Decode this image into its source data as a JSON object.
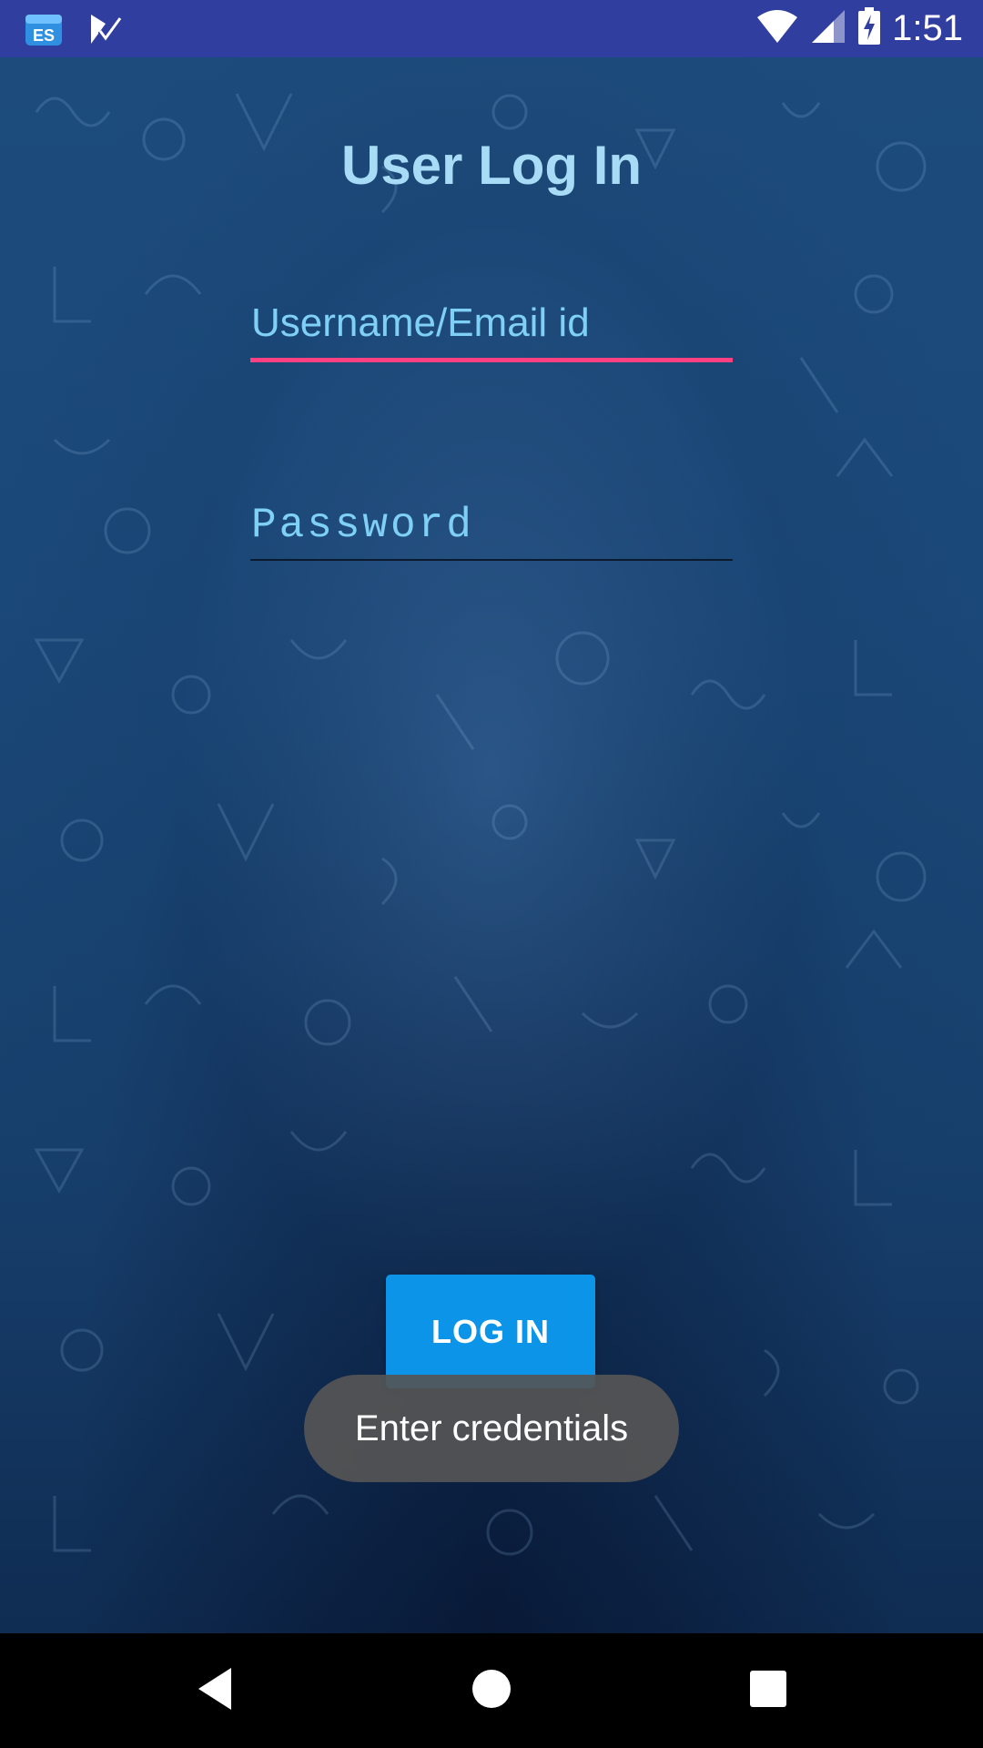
{
  "status_bar": {
    "time": "1:51",
    "left_icons": [
      "es-file-explorer-icon",
      "task-check-icon"
    ],
    "right_icons": [
      "wifi-icon",
      "signal-icon",
      "battery-charging-icon"
    ],
    "color": "#303f9f"
  },
  "login": {
    "title": "User Log In",
    "username_placeholder": "Username/Email id",
    "password_placeholder": "Password",
    "button_label": "LOG IN",
    "accent_color": "#ff4081",
    "button_color": "#0c95e8"
  },
  "toast": {
    "message": "Enter credentials"
  },
  "nav_bar": {
    "buttons": [
      "back-icon",
      "home-icon",
      "recents-icon"
    ]
  }
}
